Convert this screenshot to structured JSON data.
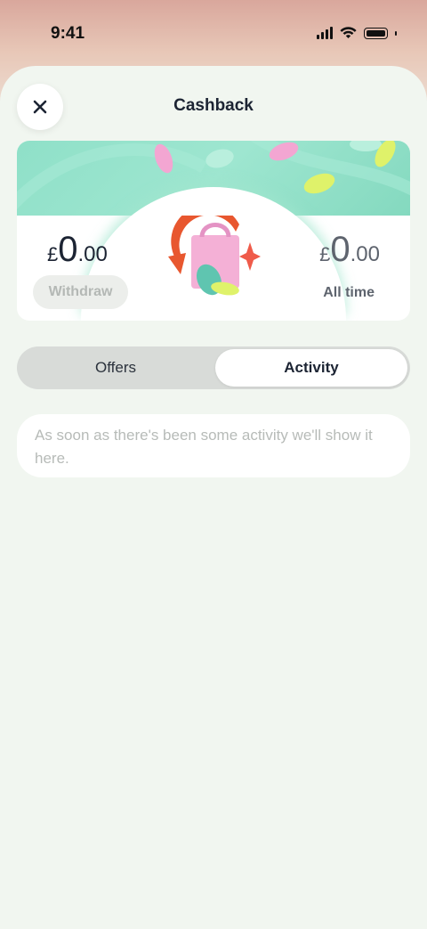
{
  "status_bar": {
    "time": "9:41"
  },
  "sheet": {
    "title": "Cashback"
  },
  "balance": {
    "withdrawable": {
      "currency": "£",
      "whole": "0",
      "decimal": ".00"
    },
    "withdraw_label": "Withdraw",
    "all_time": {
      "currency": "£",
      "whole": "0",
      "decimal": ".00"
    },
    "all_time_label": "All time"
  },
  "tabs": [
    {
      "label": "Offers",
      "selected": false
    },
    {
      "label": "Activity",
      "selected": true
    }
  ],
  "empty_state": {
    "text": "As soon as there's been some activity we'll show it here."
  },
  "colors": {
    "banner": "#8fe0c8",
    "sheet_bg": "#f1f6f0",
    "text_dark": "#1c2433"
  },
  "icons": [
    "close-icon",
    "cashback-bag-illustration",
    "signal-icon",
    "wifi-icon",
    "battery-icon"
  ]
}
